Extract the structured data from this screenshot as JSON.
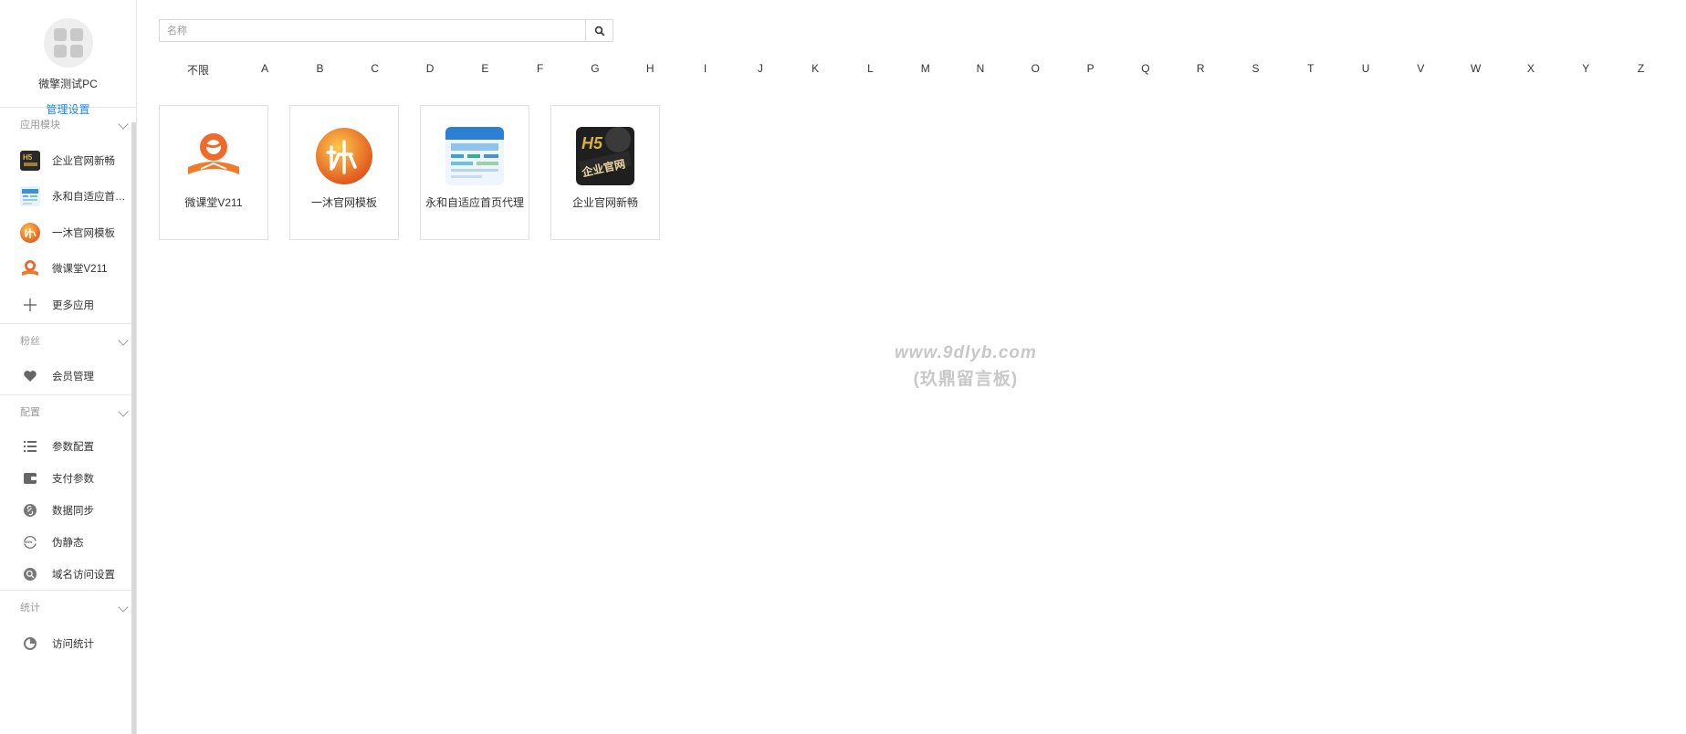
{
  "sidebar": {
    "account_name": "微擎测试PC",
    "manage_link": "管理设置",
    "sections": [
      {
        "title": "应用模块",
        "items": [
          {
            "label": "企业官网新畅",
            "icon": "qiye-app-icon"
          },
          {
            "label": "永和自适应首页...",
            "icon": "yonghe-app-icon"
          },
          {
            "label": "一沐官网模板",
            "icon": "yimu-app-icon"
          },
          {
            "label": "微课堂V211",
            "icon": "weiketang-app-icon"
          },
          {
            "label": "更多应用",
            "icon": "plus-icon"
          }
        ]
      },
      {
        "title": "粉丝",
        "items": [
          {
            "label": "会员管理",
            "icon": "heart-icon"
          }
        ]
      },
      {
        "title": "配置",
        "items": [
          {
            "label": "参数配置",
            "icon": "list-icon"
          },
          {
            "label": "支付参数",
            "icon": "wallet-icon"
          },
          {
            "label": "数据同步",
            "icon": "link-icon"
          },
          {
            "label": "伪静态",
            "icon": "globe-icon"
          },
          {
            "label": "域名访问设置",
            "icon": "domain-icon"
          }
        ]
      },
      {
        "title": "统计",
        "items": [
          {
            "label": "访问统计",
            "icon": "stats-icon"
          }
        ]
      }
    ]
  },
  "search": {
    "placeholder": "名称",
    "value": ""
  },
  "letter_filter": [
    "不限",
    "A",
    "B",
    "C",
    "D",
    "E",
    "F",
    "G",
    "H",
    "I",
    "J",
    "K",
    "L",
    "M",
    "N",
    "O",
    "P",
    "Q",
    "R",
    "S",
    "T",
    "U",
    "V",
    "W",
    "X",
    "Y",
    "Z"
  ],
  "apps": [
    {
      "name": "微课堂V211",
      "icon": "weiketang-app-icon"
    },
    {
      "name": "一沐官网模板",
      "icon": "yimu-app-icon"
    },
    {
      "name": "永和自适应首页代理",
      "icon": "yonghe-app-icon"
    },
    {
      "name": "企业官网新畅",
      "icon": "qiye-app-icon"
    }
  ],
  "watermark": {
    "line1": "www.9dlyb.com",
    "line2": "(玖鼎留言板)"
  },
  "colors": {
    "link": "#1e88e5",
    "border": "#e2e2e2",
    "muted": "#9a9a9a"
  }
}
